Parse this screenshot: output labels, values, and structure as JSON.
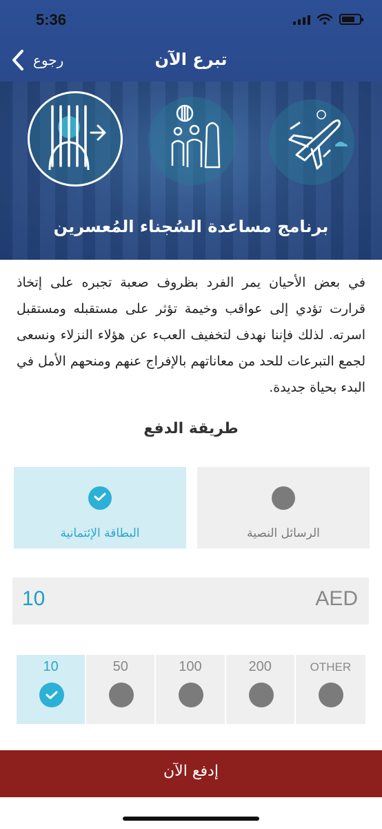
{
  "status_bar": {
    "time": "5:36"
  },
  "nav": {
    "title": "تبرع الآن",
    "back_label": "رجوع"
  },
  "banner": {
    "title": "برنامج مساعدة السُجناء المُعسرين",
    "icons": [
      "prisoner-release-icon",
      "family-icon",
      "airplane-icon"
    ]
  },
  "description": "في بعض الأحيان يمر الفرد بظروف صعبة تجبره على إتخاذ قرارت تؤدي إلى عواقب وخيمة تؤثر على مستقبله ومستقبل اسرته. لذلك فإننا نهدف لتخفيف العبء عن هؤلاء النزلاء ونسعى لجمع التبرعات للحد من معاناتهم بالإفراج عنهم ومنحهم الأمل في البدء بحياة جديدة.",
  "payment": {
    "title": "طريقة الدفع",
    "methods": [
      {
        "label": "البطاقة الإئتمانية",
        "selected": true
      },
      {
        "label": "الرسائل النصية",
        "selected": false
      }
    ]
  },
  "amount": {
    "value": "10",
    "currency": "AED"
  },
  "amount_options": [
    {
      "label": "10",
      "selected": true
    },
    {
      "label": "50",
      "selected": false
    },
    {
      "label": "100",
      "selected": false
    },
    {
      "label": "200",
      "selected": false
    },
    {
      "label": "OTHER",
      "selected": false
    }
  ],
  "pay_button": {
    "label": "إدفع الآن"
  },
  "colors": {
    "header": "#2d4f95",
    "accent": "#2bb1d5",
    "pay_button": "#8d1f1d",
    "selected_bg": "#d3edf4"
  }
}
